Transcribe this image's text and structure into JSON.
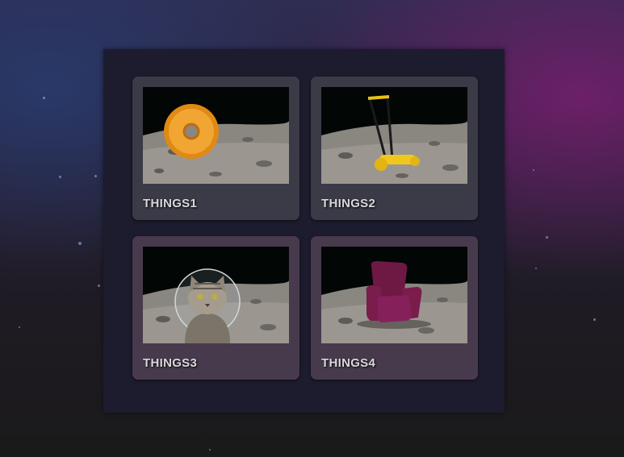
{
  "gallery": {
    "items": [
      {
        "label": "THINGS1",
        "icon": "donut-icon"
      },
      {
        "label": "THINGS2",
        "icon": "lawnmower-icon"
      },
      {
        "label": "THINGS3",
        "icon": "astronaut-cat-icon"
      },
      {
        "label": "THINGS4",
        "icon": "armchair-icon"
      }
    ]
  },
  "colors": {
    "card_top": "#3b3a47",
    "card_bottom": "#483a4d",
    "label": "#d8d8dc",
    "panel": "#1d1b2e"
  }
}
